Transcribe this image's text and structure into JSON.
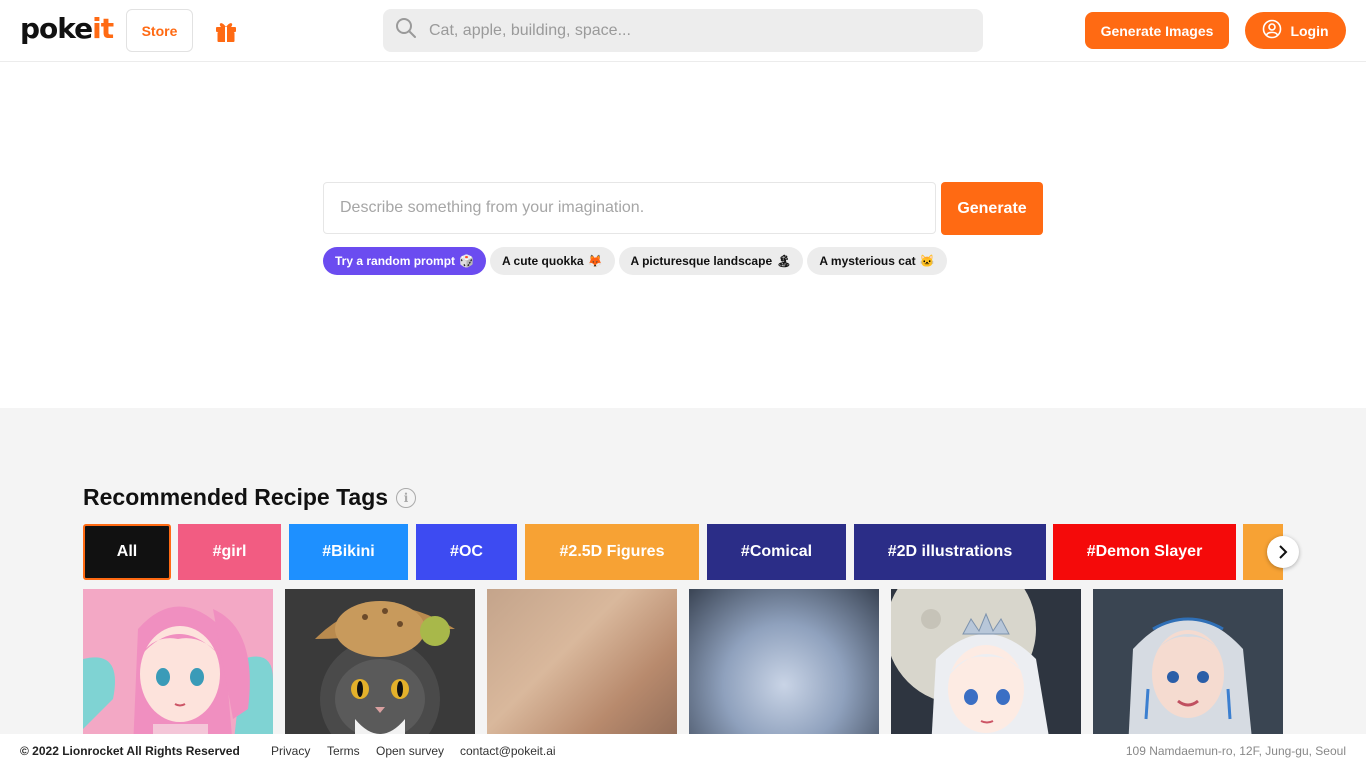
{
  "header": {
    "logo_main": "poke",
    "logo_accent": "it",
    "store_label": "Store",
    "search_placeholder": "Cat, apple, building, space...",
    "generate_images_label": "Generate Images",
    "login_label": "Login"
  },
  "hero": {
    "prompt_placeholder": "Describe something from your imagination.",
    "generate_label": "Generate",
    "chips": [
      {
        "label": "Try a random prompt",
        "emoji": "🎲"
      },
      {
        "label": "A cute quokka",
        "emoji": "🦊"
      },
      {
        "label": "A picturesque landscape",
        "emoji": "🏝"
      },
      {
        "label": "A mysterious cat",
        "emoji": "🐱"
      }
    ]
  },
  "recipes": {
    "title": "Recommended Recipe Tags",
    "tags": [
      {
        "label": "All",
        "color": "#111111"
      },
      {
        "label": "#girl",
        "color": "#f25c82"
      },
      {
        "label": "#Bikini",
        "color": "#1e90ff"
      },
      {
        "label": "#OC",
        "color": "#3d4bf2"
      },
      {
        "label": "#2.5D Figures",
        "color": "#f7a234"
      },
      {
        "label": "#Comical",
        "color": "#2b2d87"
      },
      {
        "label": "#2D illustrations",
        "color": "#2b2d87"
      },
      {
        "label": "#Demon Slayer",
        "color": "#f50a0a"
      },
      {
        "label": "",
        "color": "#f7a234"
      }
    ],
    "thumbnails": [
      {
        "icon": "anime-girl-pink-hair-image"
      },
      {
        "icon": "cat-with-hat-image"
      },
      {
        "icon": "blurred-image"
      },
      {
        "icon": "blurred-image"
      },
      {
        "icon": "anime-girl-tiara-moon-image"
      },
      {
        "icon": "silver-hair-girl-image"
      }
    ]
  },
  "footer": {
    "copyright": "© 2022 Lionrocket All Rights Reserved",
    "privacy": "Privacy",
    "terms": "Terms",
    "survey": "Open survey",
    "contact": "contact@pokeit.ai",
    "address": "109 Namdaemun-ro, 12F, Jung-gu, Seoul"
  },
  "colors": {
    "accent": "#ff6a13",
    "random_chip": "#6b4cf0"
  }
}
